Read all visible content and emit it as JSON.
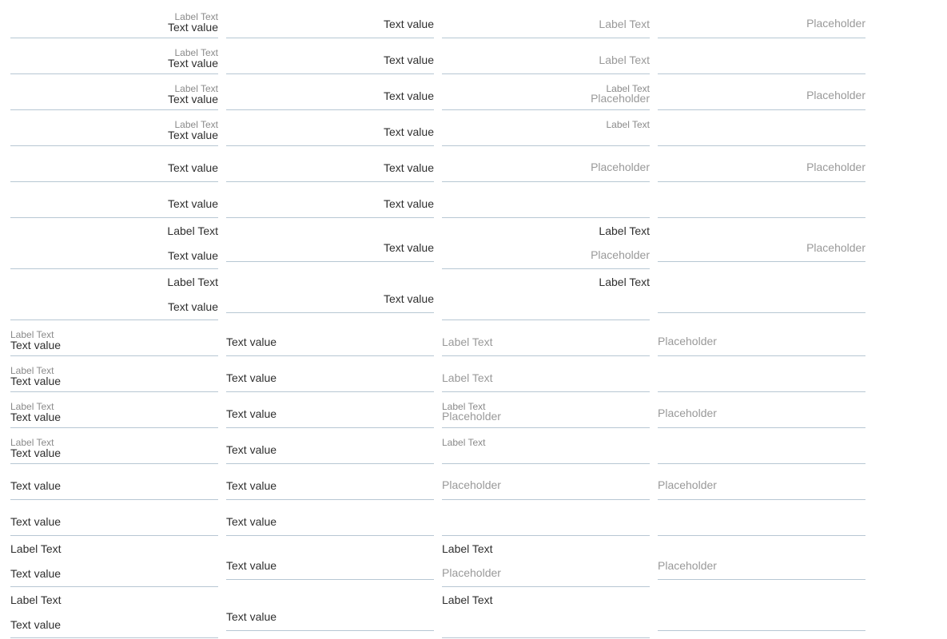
{
  "strings": {
    "label": "Label Text",
    "value": "Text value",
    "placeholder": "Placeholder"
  }
}
